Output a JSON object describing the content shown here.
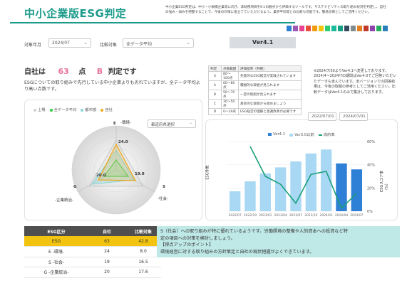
{
  "header": {
    "title": "中小企業版ESG判定",
    "description": "中小企業ESG判定は、中小・小規模企業等に向き、非財務項目を6つの観点から評価するツールです。サステナビリティの取り組み状況を判定し、自社の強み・弱みを把握することで、今後の対策に役立てていただけるよう、業界平均等との比較も可能です。簡易診断としてご活用ください。",
    "swatch_colors": [
      "#2e7fd6",
      "#9b59b6",
      "#e84393",
      "#e74c3c",
      "#f39c12",
      "#f1c40f",
      "#2ecc71",
      "#1abc9c",
      "#16a085",
      "#34495e",
      "#7f8c8d",
      "#e67e22",
      "#c0392b",
      "#8e44ad",
      "#27ae60",
      "#2980b9"
    ]
  },
  "filters": {
    "year_label": "対象年月",
    "year_value": "2024/07",
    "compare_label": "比較対象",
    "compare_value": "全データ平均",
    "version": "Ver4.1"
  },
  "result": {
    "prefix": "自社は",
    "score": "63",
    "unit": "点",
    "grade": "B",
    "suffix": "判定です",
    "description": "ESGについての取り組みで先行している中小企業よりも劣れていますが、全データ平均より高い点数です。"
  },
  "judge_table": {
    "headers": [
      "判定",
      "点数範囲",
      "評価基準（判断）"
    ],
    "rows": [
      {
        "grade": "S",
        "range": "80～100点",
        "desc": "先進的なESG経営が実践されています"
      },
      {
        "grade": "A",
        "range": "60～80点",
        "desc": "積極的な取組が見られます"
      },
      {
        "grade": "B",
        "range": "50～70点",
        "desc": "一定の取組が見られます"
      },
      {
        "grade": "C",
        "range": "30～50点",
        "desc": "基本的な取組から始めましょう"
      },
      {
        "grade": "D",
        "range": "0～29点",
        "desc": "ESG経営の理解と意識改革が必要です"
      }
    ]
  },
  "note": "※2024/7/30よりVer4.1へ変更しております。2024/4～2024/7の期間はVer4.0でご回答いただいたデータも含んでいます。旧バージョンでの回答結果は、今後の取組の参考としてご活用ください。比較データはVer4.1のみで集計しております。",
  "radar": {
    "legend": [
      "上場",
      "全データ平均",
      "都市部",
      "自社"
    ],
    "legend_colors": [
      "#cfcfcf",
      "#2ecc40",
      "#86d4d8",
      "#f0a81e"
    ],
    "select_value": "都道府県選択",
    "axes": {
      "top": "E",
      "top_sub": "-環境-",
      "right": "S",
      "right_sub": "-社会-",
      "left": "G",
      "left_sub": "-企業統治-"
    },
    "values": {
      "self_E": "24.0",
      "self_S": "19.0",
      "self_G": "20.0"
    }
  },
  "combo": {
    "date_from": "2022/07/01",
    "date_to": "2024/07/01",
    "legend": [
      "Ver4.1",
      "Ver3.0以前",
      "成約率"
    ],
    "legend_colors": [
      "#2e7fd6",
      "#a9d8f5",
      "#1aa07a"
    ],
    "y_left_label": "ESG件数",
    "y_right_label": "ESGスコア率（%）",
    "y_right_ticks": [
      "60%",
      "40%",
      "20%",
      "0%"
    ]
  },
  "chart_data": {
    "type": "bar",
    "categories": [
      "2022/07",
      "2022/10",
      "2023/01",
      "2023/04",
      "2023/07",
      "2023/10",
      "2024/01",
      "2024/04",
      "2024/07"
    ],
    "series": [
      {
        "name": "Ver4.1",
        "type": "bar",
        "values": [
          0,
          0,
          0,
          0,
          0,
          0,
          0,
          48,
          42
        ]
      },
      {
        "name": "Ver3.0以前",
        "type": "bar",
        "values": [
          20,
          30,
          38,
          44,
          50,
          58,
          62,
          0,
          0
        ]
      },
      {
        "name": "成約率",
        "type": "line",
        "values": [
          null,
          65,
          35,
          27,
          8,
          37,
          40,
          3,
          18
        ]
      }
    ]
  },
  "data_table": {
    "headers": [
      "ESG区分",
      "自社",
      "比較対象"
    ],
    "rows": [
      {
        "label": "ESG",
        "self": "63",
        "compare": "42.8"
      },
      {
        "label": "E -環境-",
        "self": "24",
        "compare": "8.0"
      },
      {
        "label": "S -社会-",
        "self": "19",
        "compare": "16.5"
      },
      {
        "label": "G -企業統治-",
        "self": "20",
        "compare": "17.6"
      }
    ]
  },
  "advice": {
    "line1": "S（社会）への取り組みが特に優れているようです。労働環境の整備や人的資本への投資など特",
    "line2": "定の項目への対策を検討しましょう。",
    "line3": "【得点アップのポイント】",
    "line4": "環境経営に対する取り組みの方針策定と自社の現状把握がよくできています。"
  }
}
